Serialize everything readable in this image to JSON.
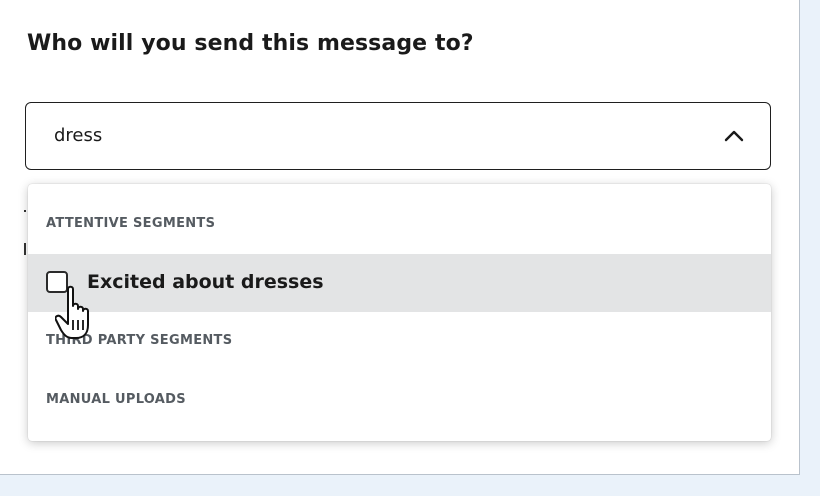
{
  "heading": "Who will you send this message to?",
  "search": {
    "value": "dress"
  },
  "dropdown": {
    "groups": [
      {
        "label": "ATTENTIVE SEGMENTS"
      },
      {
        "label": "THIRD PARTY SEGMENTS"
      },
      {
        "label": "MANUAL UPLOADS"
      }
    ],
    "options": [
      {
        "label": "Excited about dresses",
        "checked": false,
        "hovered": true
      }
    ]
  },
  "icons": {
    "toggle": "chevron-up-icon",
    "checkbox": "checkbox-unchecked-icon",
    "cursor": "hand-pointer-cursor-icon"
  },
  "colors": {
    "page_bg": "#eaf2fa",
    "hover_row": "#e3e4e5",
    "text": "#1a1a1a",
    "group_header": "#555b61"
  }
}
